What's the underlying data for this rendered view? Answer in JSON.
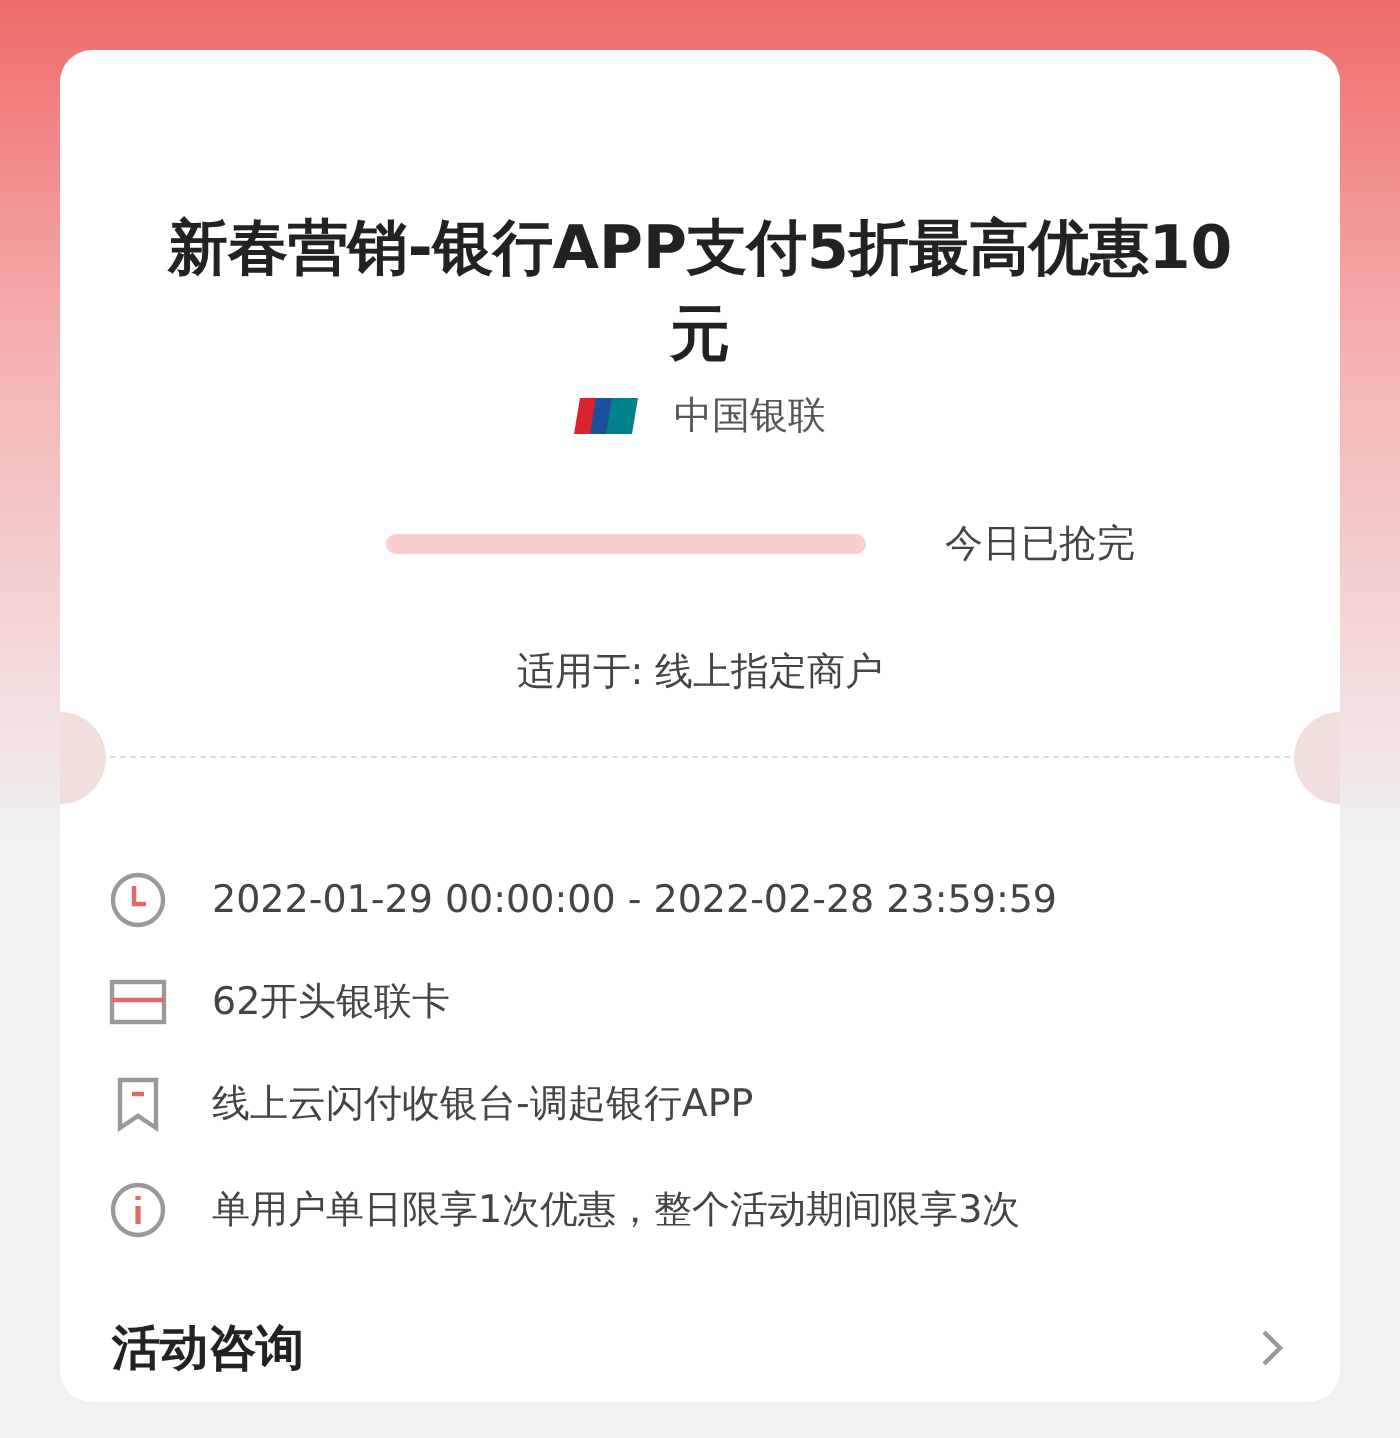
{
  "coupon": {
    "title": "新春营销-银行APP支付5折最高优惠10元",
    "issuer": "中国银联",
    "progress": {
      "level": 1,
      "status": "今日已抢完"
    },
    "scope": "适用于: 线上指定商户"
  },
  "details": [
    {
      "kind": "time",
      "text": "2022-01-29 00:00:00 - 2022-02-28 23:59:59"
    },
    {
      "kind": "card",
      "text": "62开头银联卡"
    },
    {
      "kind": "channel",
      "text": "线上云闪付收银台-调起银行APP"
    },
    {
      "kind": "info",
      "text": "单用户单日限享1次优惠，整个活动期间限享3次"
    }
  ],
  "consult": {
    "label": "活动咨询"
  }
}
